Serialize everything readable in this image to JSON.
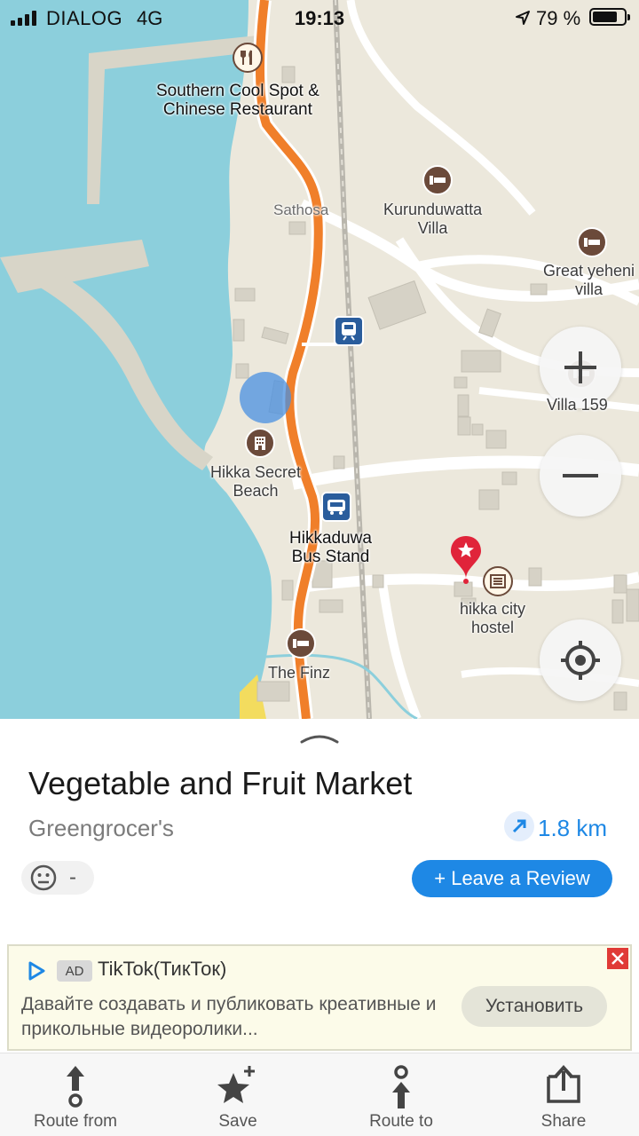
{
  "status_bar": {
    "carrier": "DIALOG",
    "network": "4G",
    "time": "19:13",
    "battery": "79 %",
    "battery_level": 0.79
  },
  "map": {
    "labels": {
      "southern": "Southern Cool Spot &\nChinese Restaurant",
      "sathosa": "Sathosa",
      "kurunduwatta": "Kurunduwatta\nVilla",
      "great_yeheni": "Great yeheni\nvilla",
      "villa159": "Villa 159",
      "hikka_secret": "Hikka Secret\nBeach",
      "bus_stand": "Hikkaduwa\nBus Stand",
      "hikka_city": "hikka city\nhostel",
      "the_finz": "The Finz"
    },
    "icons": {
      "restaurant": "fork-knife-icon",
      "hotel": "bed-icon",
      "train": "train-icon",
      "bus": "bus-icon",
      "building": "hotel-building-icon",
      "hostel": "hostel-icon",
      "marker": "red-star-marker-icon"
    },
    "controls": [
      "zoom-in",
      "zoom-out",
      "my-location"
    ]
  },
  "place": {
    "title": "Vegetable and Fruit Market",
    "category": "Greengrocer's",
    "distance": "1.8 km",
    "rating": "-",
    "review_button": "+ Leave a Review"
  },
  "ad": {
    "badge": "AD",
    "title": "TikTok(ТикТок)",
    "text": "Давайте создавать и публиковать креативные и прикольные видеоролики...",
    "install": "Установить"
  },
  "tabs": [
    {
      "label": "Route from",
      "icon": "route-from-icon"
    },
    {
      "label": "Save",
      "icon": "star-plus-icon"
    },
    {
      "label": "Route to",
      "icon": "route-to-icon"
    },
    {
      "label": "Share",
      "icon": "share-icon"
    }
  ],
  "colors": {
    "water": "#8ccfdc",
    "land": "#ece8dc",
    "main_road": "#f07f2a",
    "accent": "#1e88e5",
    "marker": "#e0243a"
  }
}
